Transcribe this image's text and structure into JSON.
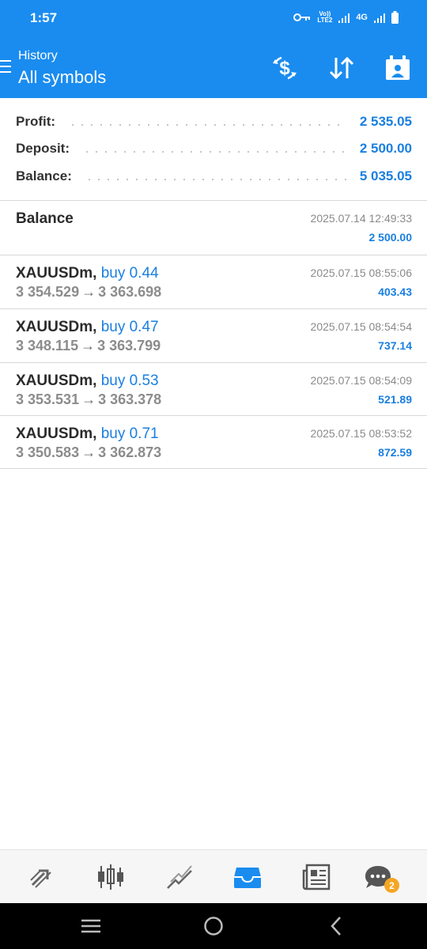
{
  "status_bar": {
    "time": "1:57",
    "volte_top": "Vo))",
    "volte_bottom": "LTE2",
    "network": "4G"
  },
  "header": {
    "subtitle": "History",
    "title": "All symbols"
  },
  "summary": [
    {
      "label": "Profit:",
      "value": "2 535.05"
    },
    {
      "label": "Deposit:",
      "value": "2 500.00"
    },
    {
      "label": "Balance:",
      "value": "5 035.05"
    }
  ],
  "balance_entry": {
    "title": "Balance",
    "time": "2025.07.14 12:49:33",
    "amount": "2 500.00"
  },
  "deals": [
    {
      "symbol": "XAUUSDm,",
      "direction": "buy 0.44",
      "open_price": "3 354.529",
      "close_price": "3 363.698",
      "time": "2025.07.15 08:55:06",
      "profit": "403.43"
    },
    {
      "symbol": "XAUUSDm,",
      "direction": "buy 0.47",
      "open_price": "3 348.115",
      "close_price": "3 363.799",
      "time": "2025.07.15 08:54:54",
      "profit": "737.14"
    },
    {
      "symbol": "XAUUSDm,",
      "direction": "buy 0.53",
      "open_price": "3 353.531",
      "close_price": "3 363.378",
      "time": "2025.07.15 08:54:09",
      "profit": "521.89"
    },
    {
      "symbol": "XAUUSDm,",
      "direction": "buy 0.71",
      "open_price": "3 350.583",
      "close_price": "3 362.873",
      "time": "2025.07.15 08:53:52",
      "profit": "872.59"
    }
  ],
  "price_arrow": "→",
  "bottom_nav": {
    "items": [
      "quotes-icon",
      "chart-icon",
      "trade-icon",
      "history-icon",
      "news-icon",
      "messages-icon"
    ],
    "active": "history-icon",
    "messages_badge": "2"
  },
  "colors": {
    "brand_blue": "#1a8cf0",
    "value_blue": "#1a7fe0",
    "badge_orange": "#f5a623"
  }
}
